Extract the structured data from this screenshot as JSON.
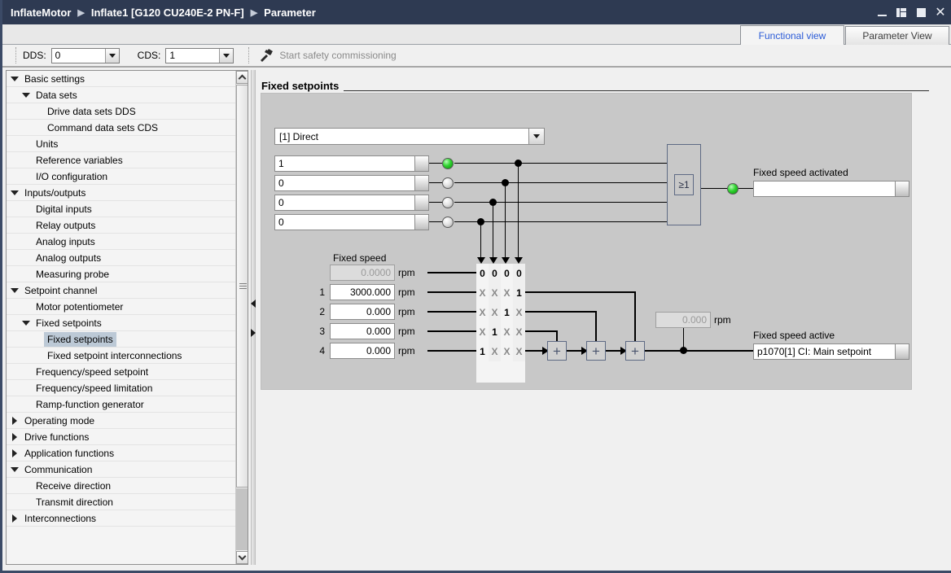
{
  "window": {
    "breadcrumb": [
      "InflateMotor",
      "Inflate1 [G120 CU240E-2 PN-F]",
      "Parameter"
    ],
    "buttons": {
      "minimize": "Minimize",
      "restore": "Restore",
      "maximize": "Maximize",
      "close": "Close"
    }
  },
  "tabs": [
    {
      "label": "Functional view",
      "active": true
    },
    {
      "label": "Parameter View",
      "active": false
    }
  ],
  "toolbar": {
    "dds_label": "DDS:",
    "dds_value": "0",
    "cds_label": "CDS:",
    "cds_value": "1",
    "safety_label": "Start safety commissioning"
  },
  "tree": [
    {
      "label": "Basic settings",
      "indent": 0,
      "twisty": "open",
      "selected": false
    },
    {
      "label": "Data sets",
      "indent": 1,
      "twisty": "open",
      "selected": false
    },
    {
      "label": "Drive data sets DDS",
      "indent": 2,
      "twisty": "none",
      "selected": false
    },
    {
      "label": "Command data sets CDS",
      "indent": 2,
      "twisty": "none",
      "selected": false
    },
    {
      "label": "Units",
      "indent": 1,
      "twisty": "none",
      "selected": false
    },
    {
      "label": "Reference variables",
      "indent": 1,
      "twisty": "none",
      "selected": false
    },
    {
      "label": "I/O configuration",
      "indent": 1,
      "twisty": "none",
      "selected": false
    },
    {
      "label": "Inputs/outputs",
      "indent": 0,
      "twisty": "open",
      "selected": false
    },
    {
      "label": "Digital inputs",
      "indent": 1,
      "twisty": "none",
      "selected": false
    },
    {
      "label": "Relay outputs",
      "indent": 1,
      "twisty": "none",
      "selected": false
    },
    {
      "label": "Analog inputs",
      "indent": 1,
      "twisty": "none",
      "selected": false
    },
    {
      "label": "Analog outputs",
      "indent": 1,
      "twisty": "none",
      "selected": false
    },
    {
      "label": "Measuring probe",
      "indent": 1,
      "twisty": "none",
      "selected": false
    },
    {
      "label": "Setpoint channel",
      "indent": 0,
      "twisty": "open",
      "selected": false
    },
    {
      "label": "Motor potentiometer",
      "indent": 1,
      "twisty": "none",
      "selected": false
    },
    {
      "label": "Fixed setpoints",
      "indent": 1,
      "twisty": "open",
      "selected": false
    },
    {
      "label": "Fixed setpoints",
      "indent": 2,
      "twisty": "none",
      "selected": true
    },
    {
      "label": "Fixed setpoint interconnections",
      "indent": 2,
      "twisty": "none",
      "selected": false
    },
    {
      "label": "Frequency/speed setpoint",
      "indent": 1,
      "twisty": "none",
      "selected": false
    },
    {
      "label": "Frequency/speed limitation",
      "indent": 1,
      "twisty": "none",
      "selected": false
    },
    {
      "label": "Ramp-function generator",
      "indent": 1,
      "twisty": "none",
      "selected": false
    },
    {
      "label": "Operating mode",
      "indent": 0,
      "twisty": "closed",
      "selected": false
    },
    {
      "label": "Drive functions",
      "indent": 0,
      "twisty": "closed",
      "selected": false
    },
    {
      "label": "Application functions",
      "indent": 0,
      "twisty": "closed",
      "selected": false
    },
    {
      "label": "Communication",
      "indent": 0,
      "twisty": "open",
      "selected": false
    },
    {
      "label": "Receive direction",
      "indent": 1,
      "twisty": "none",
      "selected": false
    },
    {
      "label": "Transmit direction",
      "indent": 1,
      "twisty": "none",
      "selected": false
    },
    {
      "label": "Interconnections",
      "indent": 0,
      "twisty": "closed",
      "selected": false
    }
  ],
  "page": {
    "title": "Fixed setpoints"
  },
  "diagram": {
    "mode_select": "[1] Direct",
    "selector_bits": [
      {
        "value": "1",
        "lamp": "on"
      },
      {
        "value": "0",
        "lamp": "off"
      },
      {
        "value": "0",
        "lamp": "off"
      },
      {
        "value": "0",
        "lamp": "off"
      }
    ],
    "or_gate_label": "≥1",
    "or_output_lamp": "on",
    "fixed_speed_activated_label": "Fixed speed activated",
    "fixed_speed_activated_value": "",
    "fixed_speed_header": "Fixed speed",
    "speed_rows": [
      {
        "index": "",
        "value": "0.0000",
        "unit": "rpm",
        "readonly": true
      },
      {
        "index": "1",
        "value": "3000.000",
        "unit": "rpm",
        "readonly": false
      },
      {
        "index": "2",
        "value": "0.000",
        "unit": "rpm",
        "readonly": false
      },
      {
        "index": "3",
        "value": "0.000",
        "unit": "rpm",
        "readonly": false
      },
      {
        "index": "4",
        "value": "0.000",
        "unit": "rpm",
        "readonly": false
      }
    ],
    "matrix": [
      [
        "0",
        "0",
        "0",
        "0"
      ],
      [
        "X",
        "X",
        "X",
        "1"
      ],
      [
        "X",
        "X",
        "1",
        "X"
      ],
      [
        "X",
        "1",
        "X",
        "X"
      ],
      [
        "1",
        "X",
        "X",
        "X"
      ]
    ],
    "adder_symbol": "+",
    "sum_value": "0.000",
    "sum_unit": "rpm",
    "fixed_speed_active_label": "Fixed speed active",
    "fixed_speed_active_value": "p1070[1] CI: Main setpoint"
  },
  "colors": {
    "titlebar": "#2e3a52",
    "tab_active_text": "#2b5bd7",
    "lamp_on": "#2fd22f",
    "diagram_bg": "#c8c8c8",
    "selection": "#bcc9d6"
  },
  "icons": {
    "safety": "hammer-tool-icon",
    "dropdown": "chevron-down-icon",
    "scroll_up": "chevron-up-icon",
    "scroll_down": "chevron-down-icon"
  }
}
